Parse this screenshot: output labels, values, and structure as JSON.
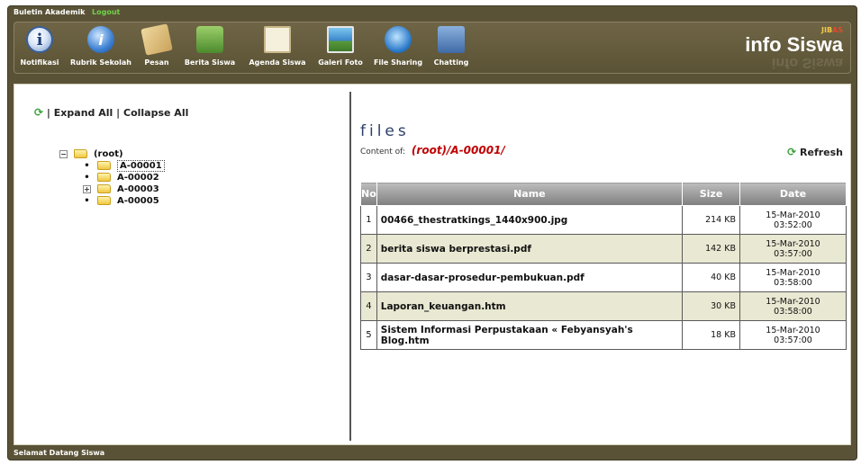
{
  "header": {
    "buletin": "Buletin Akademik",
    "logout": "Logout"
  },
  "toolbar": {
    "items": [
      {
        "label": "Notifikasi",
        "icon": "info-icon"
      },
      {
        "label": "Rubrik Sekolah",
        "icon": "info-blue-icon"
      },
      {
        "label": "Pesan",
        "icon": "envelope-icon"
      },
      {
        "label": "Berita Siswa",
        "icon": "people-icon"
      },
      {
        "label": "Agenda Siswa",
        "icon": "notepad-icon"
      },
      {
        "label": "Galeri Foto",
        "icon": "photo-icon"
      },
      {
        "label": "File Sharing",
        "icon": "file-sharing-icon"
      },
      {
        "label": "Chatting",
        "icon": "chat-icon"
      }
    ],
    "brand_small": "JIB",
    "brand_small_accent": "AS",
    "brand_title": "info Siswa"
  },
  "tree": {
    "expand_all": "Expand All",
    "collapse_all": "Collapse All",
    "separator": "|",
    "root_label": "(root)",
    "nodes": [
      "A-00001",
      "A-00002",
      "A-00003",
      "A-00005"
    ]
  },
  "files": {
    "heading": "files",
    "content_of_label": "Content of:",
    "path": "(root)/A-00001/",
    "refresh_label": "Refresh",
    "columns": [
      "No",
      "Name",
      "Size",
      "Date"
    ],
    "rows": [
      {
        "no": "1",
        "name": "00466_thestratkings_1440x900.jpg",
        "size": "214 KB",
        "date1": "15-Mar-2010",
        "date2": "03:52:00"
      },
      {
        "no": "2",
        "name": "berita siswa berprestasi.pdf",
        "size": "142 KB",
        "date1": "15-Mar-2010",
        "date2": "03:57:00"
      },
      {
        "no": "3",
        "name": "dasar-dasar-prosedur-pembukuan.pdf",
        "size": "40 KB",
        "date1": "15-Mar-2010",
        "date2": "03:58:00"
      },
      {
        "no": "4",
        "name": "Laporan_keuangan.htm",
        "size": "30 KB",
        "date1": "15-Mar-2010",
        "date2": "03:58:00"
      },
      {
        "no": "5",
        "name": "Sistem Informasi Perpustakaan « Febyansyah's Blog.htm",
        "size": "18 KB",
        "date1": "15-Mar-2010",
        "date2": "03:57:00"
      }
    ]
  },
  "footer": {
    "text": "Selamat Datang Siswa"
  }
}
